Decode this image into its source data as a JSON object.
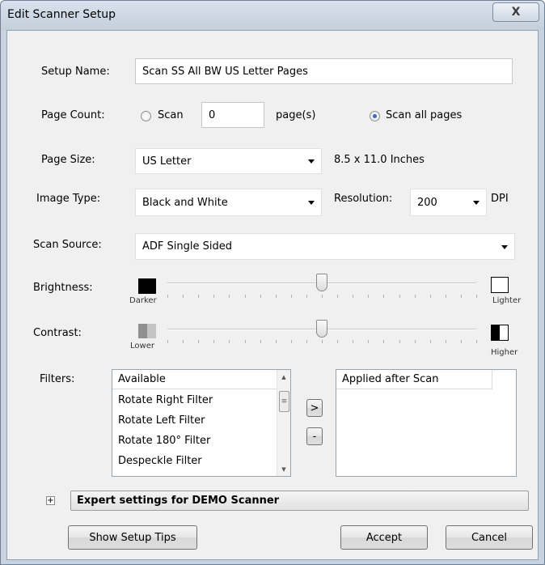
{
  "window": {
    "title": "Edit Scanner Setup",
    "close_glyph": "X"
  },
  "setup_name": {
    "label": "Setup Name:",
    "value": "Scan SS All BW US Letter Pages"
  },
  "page_count": {
    "label": "Page Count:",
    "scan_radio_label": "Scan",
    "scan_radio_checked": false,
    "count_value": "0",
    "unit_label": "page(s)",
    "scan_all_label": "Scan all pages",
    "scan_all_checked": true
  },
  "page_size": {
    "label": "Page Size:",
    "selected": "US Letter",
    "dimensions": "8.5 x 11.0 Inches"
  },
  "image_type": {
    "label": "Image Type:",
    "selected": "Black and White",
    "resolution_label": "Resolution:",
    "resolution_value": "200",
    "resolution_unit": "DPI"
  },
  "scan_source": {
    "label": "Scan Source:",
    "selected": "ADF Single Sided"
  },
  "brightness": {
    "label": "Brightness:",
    "min_label": "Darker",
    "max_label": "Lighter",
    "level": 0.5
  },
  "contrast": {
    "label": "Contrast:",
    "min_label": "Lower",
    "max_label": "Higher",
    "level": 0.5
  },
  "filters": {
    "label": "Filters:",
    "available_header": "Available",
    "available_items": [
      "Rotate Right Filter",
      "Rotate Left Filter",
      "Rotate 180° Filter",
      "Despeckle Filter"
    ],
    "applied_header": "Applied after Scan",
    "applied_items": [],
    "add_label": ">",
    "remove_label": "-"
  },
  "expert": {
    "expander_glyph": "+",
    "label": "Expert settings for DEMO Scanner"
  },
  "buttons": {
    "tips": "Show Setup Tips",
    "accept": "Accept",
    "cancel": "Cancel"
  },
  "colors": {
    "title_bar": "#c4cfdc",
    "dialog_bg": "#f0f0f0",
    "radio_dot": "#2b6ed1"
  }
}
